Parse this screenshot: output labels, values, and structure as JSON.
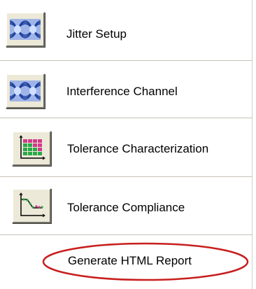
{
  "menu": {
    "items": [
      {
        "label": "Jitter Setup",
        "icon": "jitter-eye-icon"
      },
      {
        "label": "Interference Channel",
        "icon": "interference-eye-icon"
      },
      {
        "label": "Tolerance Characterization",
        "icon": "tolerance-char-chart-icon"
      },
      {
        "label": "Tolerance Compliance",
        "icon": "tolerance-compliance-chart-icon"
      }
    ],
    "report_label": "Generate HTML Report"
  },
  "colors": {
    "eye_blue": "#3a68c8",
    "highlight_ellipse": "#c81e1e",
    "button_face": "#ece9d8"
  }
}
